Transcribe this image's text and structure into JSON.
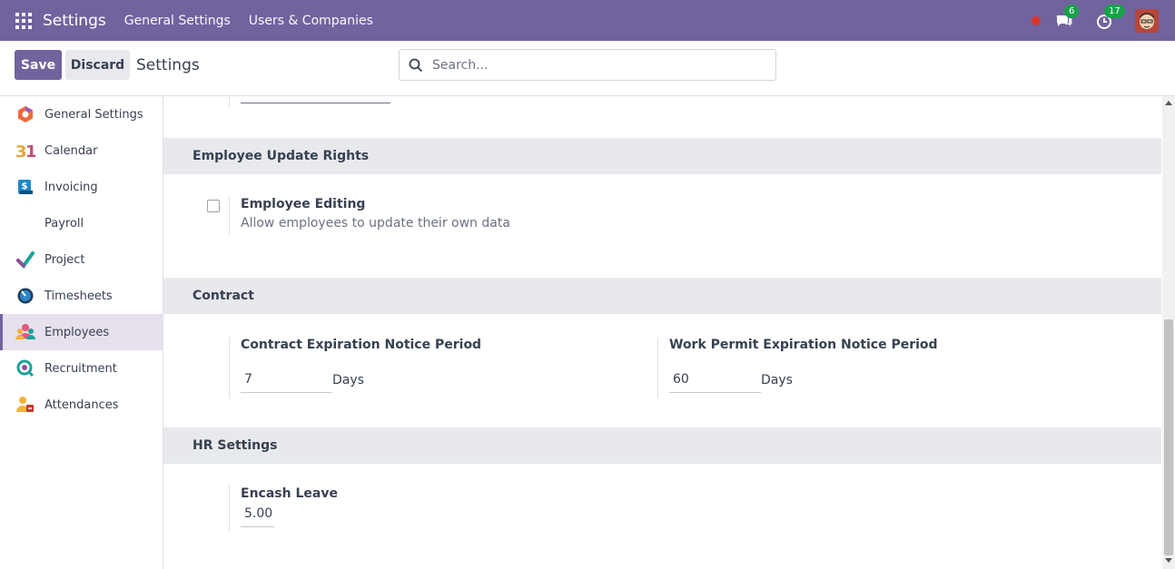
{
  "topbar": {
    "app_title": "Settings",
    "menu": [
      "General Settings",
      "Users & Companies"
    ],
    "messages_count": "6",
    "activities_count": "17"
  },
  "control_panel": {
    "save_label": "Save",
    "discard_label": "Discard",
    "title": "Settings",
    "search_placeholder": "Search..."
  },
  "sidebar": {
    "items": [
      {
        "label": "General Settings",
        "icon": "general-settings-icon"
      },
      {
        "label": "Calendar",
        "icon": "calendar-icon"
      },
      {
        "label": "Invoicing",
        "icon": "invoicing-icon"
      },
      {
        "label": "Payroll",
        "icon": "payroll-icon"
      },
      {
        "label": "Project",
        "icon": "project-icon"
      },
      {
        "label": "Timesheets",
        "icon": "timesheets-icon"
      },
      {
        "label": "Employees",
        "icon": "employees-icon",
        "active": true
      },
      {
        "label": "Recruitment",
        "icon": "recruitment-icon"
      },
      {
        "label": "Attendances",
        "icon": "attendances-icon"
      }
    ]
  },
  "sections": {
    "update_rights": {
      "title": "Employee Update Rights",
      "setting_label": "Employee Editing",
      "setting_desc": "Allow employees to update their own data",
      "checked": false
    },
    "contract": {
      "title": "Contract",
      "contract_label": "Contract Expiration Notice Period",
      "contract_value": "7",
      "contract_unit": "Days",
      "permit_label": "Work Permit Expiration Notice Period",
      "permit_value": "60",
      "permit_unit": "Days"
    },
    "hr": {
      "title": "HR Settings",
      "encash_label": "Encash Leave",
      "encash_value": "5.00"
    }
  },
  "colors": {
    "brand": "#71639e",
    "badge": "#17a24a",
    "section_bg": "#e7e9ed"
  }
}
